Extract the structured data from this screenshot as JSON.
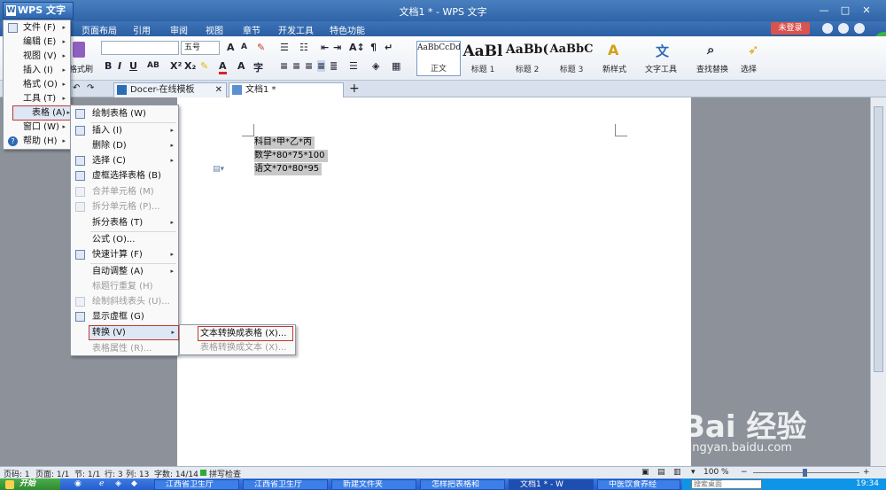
{
  "titlebar": {
    "app_button": "WPS 文字",
    "doc_title": "文档1 * - WPS 文字",
    "min": "—",
    "max": "□",
    "close": "✕"
  },
  "menubar": {
    "tabs": [
      "页面布局",
      "引用",
      "审阅",
      "视图",
      "章节",
      "开发工具",
      "特色功能"
    ],
    "login": "未登录"
  },
  "ribbon": {
    "format_painter": "格式刷",
    "font_size": "五号",
    "styles": [
      {
        "preview": "AaBbCcDd",
        "label": "正文"
      },
      {
        "preview": "AaBl",
        "label": "标题 1"
      },
      {
        "preview": "AaBb(",
        "label": "标题 2"
      },
      {
        "preview": "AaBbC",
        "label": "标题 3"
      }
    ],
    "new_style": "新样式",
    "text_tools": "文字工具",
    "find_replace": "查找替换",
    "select": "选择"
  },
  "doc_tabs": [
    {
      "label": "Docer-在线模板"
    },
    {
      "label": "文档1 *"
    }
  ],
  "document": {
    "lines": [
      "科目*甲*乙*丙",
      "数学*80*75*100",
      "语文*70*80*95"
    ]
  },
  "wps_menu": {
    "items": [
      {
        "label": "文件 (F)"
      },
      {
        "label": "编辑 (E)"
      },
      {
        "label": "视图 (V)"
      },
      {
        "label": "插入 (I)"
      },
      {
        "label": "格式 (O)"
      },
      {
        "label": "工具 (T)"
      },
      {
        "label": "表格 (A)"
      },
      {
        "label": "窗口 (W)"
      },
      {
        "label": "帮助 (H)"
      }
    ]
  },
  "table_menu": {
    "items": [
      {
        "label": "绘制表格 (W)"
      },
      {
        "label": "插入 (I)"
      },
      {
        "label": "删除 (D)"
      },
      {
        "label": "选择 (C)"
      },
      {
        "label": "虚框选择表格 (B)"
      },
      {
        "label": "合并单元格 (M)"
      },
      {
        "label": "拆分单元格 (P)..."
      },
      {
        "label": "拆分表格 (T)"
      },
      {
        "label": "公式 (O)..."
      },
      {
        "label": "快速计算 (F)"
      },
      {
        "label": "自动调整 (A)"
      },
      {
        "label": "标题行重复 (H)"
      },
      {
        "label": "绘制斜线表头 (U)..."
      },
      {
        "label": "显示虚框 (G)"
      },
      {
        "label": "转换 (V)"
      },
      {
        "label": "表格属性 (R)..."
      }
    ]
  },
  "convert_menu": {
    "items": [
      {
        "label": "文本转换成表格 (X)..."
      },
      {
        "label": "表格转换成文本 (X)..."
      }
    ]
  },
  "statusbar": {
    "page_num": "页码: 1",
    "pages": "页面: 1/1",
    "section": "节: 1/1",
    "row": "行: 3",
    "col": "列: 13",
    "words": "字数: 14/14",
    "spell": "拼写检查",
    "zoom": "100 %"
  },
  "taskbar": {
    "start": "开始",
    "buttons": [
      "江西省卫生厅",
      "江西省卫生厅",
      "新建文件夹",
      "怎样把表格和",
      "文档1 * - W",
      "中医饮食养经"
    ],
    "search_placeholder": "搜索桌面",
    "clock": "19:34"
  },
  "watermark": {
    "brand": "Bai 经验",
    "url": "jingyan.baidu.com"
  }
}
